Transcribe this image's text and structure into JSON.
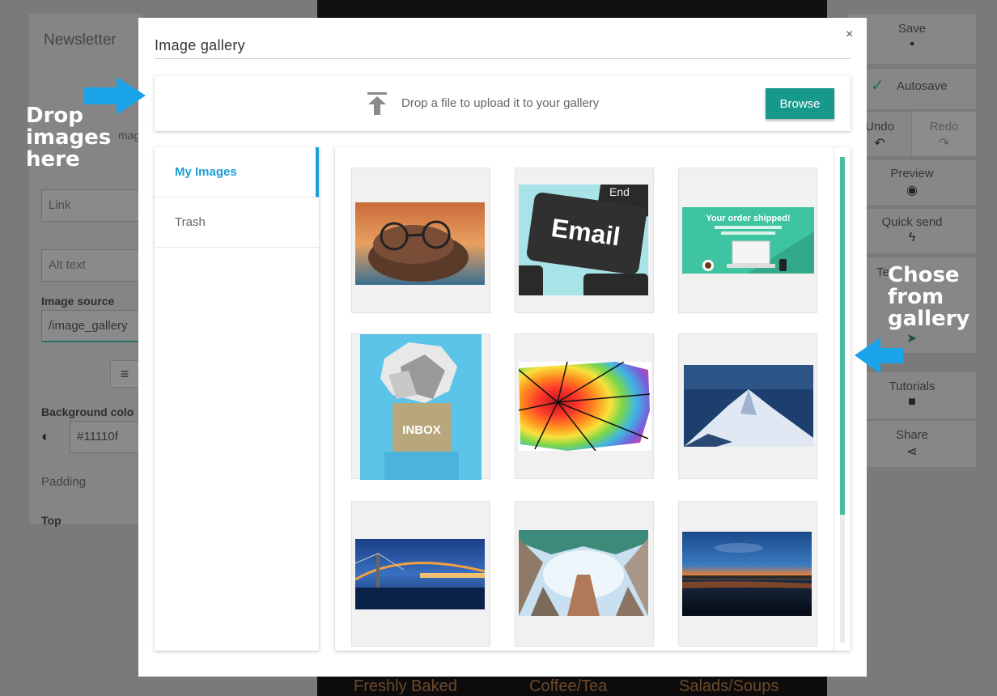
{
  "background": {
    "left_panel": {
      "title": "Newsletter",
      "fragment_mag": "mag",
      "link_placeholder": "Link",
      "alt_placeholder": "Alt text",
      "image_source_label": "Image source",
      "image_source_value": "/image_gallery",
      "background_color_label": "Background colo",
      "background_color_value": "#11110f",
      "padding_label": "Padding",
      "top_label": "Top"
    },
    "right_panel": {
      "save": "Save",
      "autosave": "Autosave",
      "undo": "Undo",
      "redo": "Redo",
      "preview": "Preview",
      "quick_send": "Quick send",
      "test_fragment": "Te",
      "tutorials": "Tutorials",
      "share": "Share"
    },
    "footer_menu": [
      "Freshly Baked",
      "Coffee/Tea",
      "Salads/Soups"
    ]
  },
  "modal": {
    "title": "Image gallery",
    "close_symbol": "×",
    "dropzone": {
      "text": "Drop a file to upload it to your gallery",
      "browse_label": "Browse"
    },
    "sidebar": [
      {
        "label": "My Images",
        "active": true
      },
      {
        "label": "Trash",
        "active": false
      }
    ],
    "images": [
      {
        "name": "shoe-glasses-photo"
      },
      {
        "name": "email-key-photo",
        "caption": "Email"
      },
      {
        "name": "order-shipped-graphic",
        "caption": "Your order shipped!"
      },
      {
        "name": "inbox-box-graphic",
        "caption": "INBOX"
      },
      {
        "name": "rainbow-umbrella-photo"
      },
      {
        "name": "snowy-mountain-photo"
      },
      {
        "name": "bridge-night-photo"
      },
      {
        "name": "skyscrapers-photo"
      },
      {
        "name": "sunset-lake-photo"
      }
    ],
    "scroll_position": 0.0
  },
  "annotations": {
    "left": [
      "Drop",
      "images",
      "here"
    ],
    "right": [
      "Chose",
      "from",
      "gallery"
    ],
    "arrow_color": "#1aa3e8"
  },
  "colors": {
    "accent_green": "#16998a",
    "active_blue": "#1a9fd6",
    "scroll_thumb": "#4cbba6"
  }
}
